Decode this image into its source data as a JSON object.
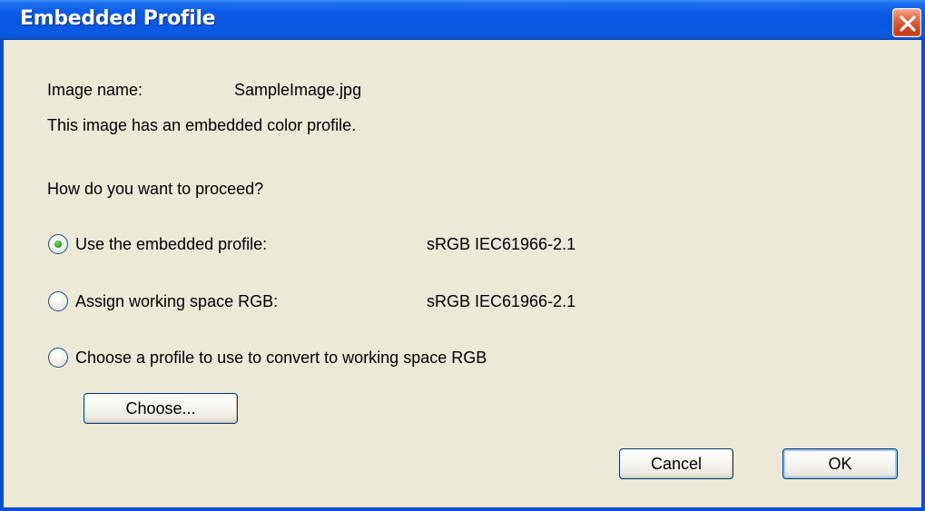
{
  "dialog": {
    "title": "Embedded Profile",
    "close_icon": "close-icon"
  },
  "image_name": {
    "label": "Image name:",
    "value": "SampleImage.jpg"
  },
  "message": "This image has an embedded color profile.",
  "question": "How do you want to proceed?",
  "options": [
    {
      "label": "Use the embedded profile:",
      "profile": "sRGB IEC61966-2.1",
      "selected": true
    },
    {
      "label": "Assign working space RGB:",
      "profile": "sRGB IEC61966-2.1",
      "selected": false
    },
    {
      "label": "Choose a profile to use to convert to working space RGB",
      "selected": false
    }
  ],
  "buttons": {
    "choose": "Choose...",
    "cancel": "Cancel",
    "ok": "OK"
  },
  "colors": {
    "titlebar": "#0756e3",
    "client_bg": "#ece9d8",
    "close_button": "#d1471f",
    "radio_selected": "#31a821"
  }
}
